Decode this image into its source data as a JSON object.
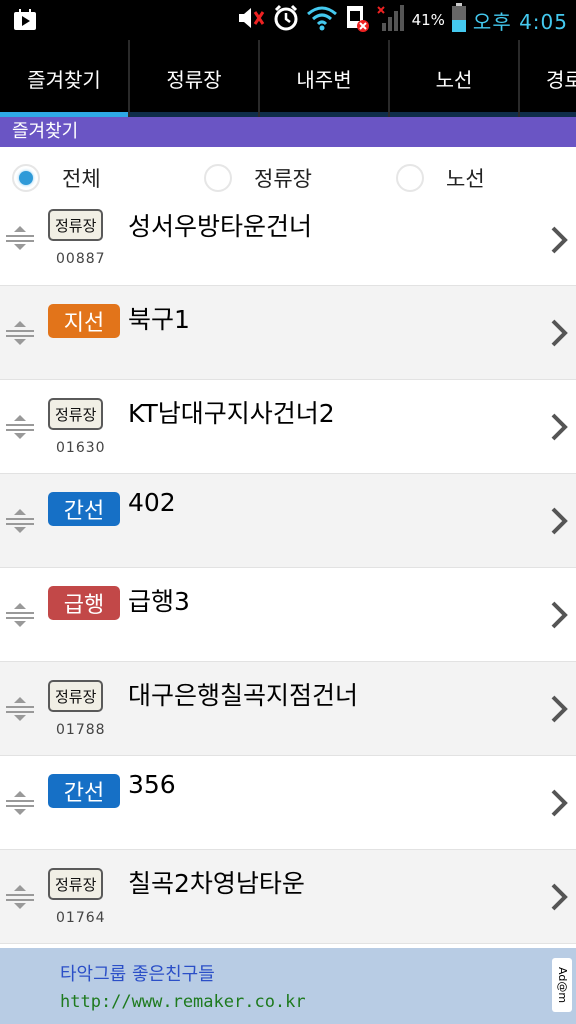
{
  "status_bar": {
    "battery_percent": "41%",
    "time": "오후 4:05",
    "icons": [
      "play-store-icon",
      "mute-icon",
      "alarm-icon",
      "wifi-icon",
      "sim-icon",
      "signal-icon",
      "battery-icon"
    ]
  },
  "tabs": [
    {
      "label": "즐겨찾기",
      "active": true
    },
    {
      "label": "정류장",
      "active": false
    },
    {
      "label": "내주변",
      "active": false
    },
    {
      "label": "노선",
      "active": false
    },
    {
      "label": "경로",
      "active": false
    }
  ],
  "section_header": "즐겨찾기",
  "filters": [
    {
      "label": "전체",
      "selected": true
    },
    {
      "label": "정류장",
      "selected": false
    },
    {
      "label": "노선",
      "selected": false
    }
  ],
  "favorites": [
    {
      "type": "정류장",
      "name": "성서우방타운건너",
      "code": "00887"
    },
    {
      "type": "지선",
      "name": "북구1",
      "code": ""
    },
    {
      "type": "정류장",
      "name": "KT남대구지사건너2",
      "code": "01630"
    },
    {
      "type": "간선",
      "name": "402",
      "code": ""
    },
    {
      "type": "급행",
      "name": "급행3",
      "code": ""
    },
    {
      "type": "정류장",
      "name": "대구은행칠곡지점건너",
      "code": "01788"
    },
    {
      "type": "간선",
      "name": "356",
      "code": ""
    },
    {
      "type": "정류장",
      "name": "칠곡2차영남타운",
      "code": "01764"
    }
  ],
  "badge_colors": {
    "정류장": "#f1efe5",
    "지선": "#e2741a",
    "간선": "#1670c6",
    "급행": "#c24848"
  },
  "ad": {
    "line1": "타악그룹 좋은친구들",
    "line2": "http://www.remaker.co.kr",
    "tag": "Ad@m"
  }
}
